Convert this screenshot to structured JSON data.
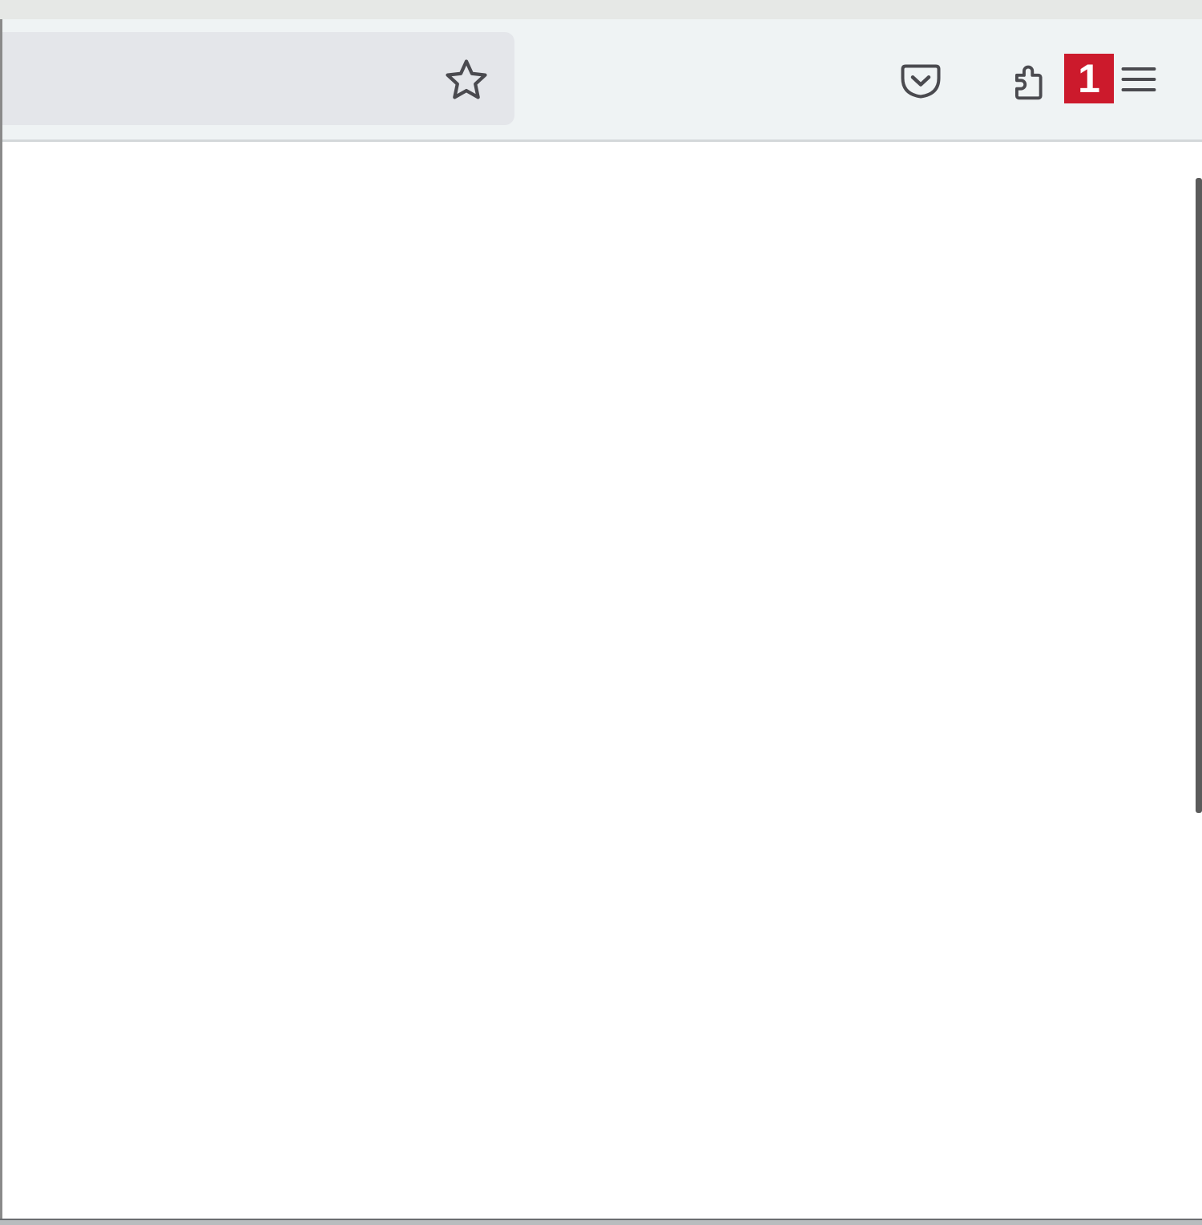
{
  "toolbar": {
    "bookmark_icon": "star-icon",
    "pocket_icon": "pocket-icon",
    "extensions_icon": "puzzle-icon",
    "menu_icon": "hamburger-menu-icon",
    "badge_text": "1",
    "badge_color": "#cc1a2c"
  },
  "colors": {
    "toolbar_bg": "#eff3f4",
    "urlbar_bg": "#e4e6ea",
    "content_bg": "#ffffff"
  }
}
